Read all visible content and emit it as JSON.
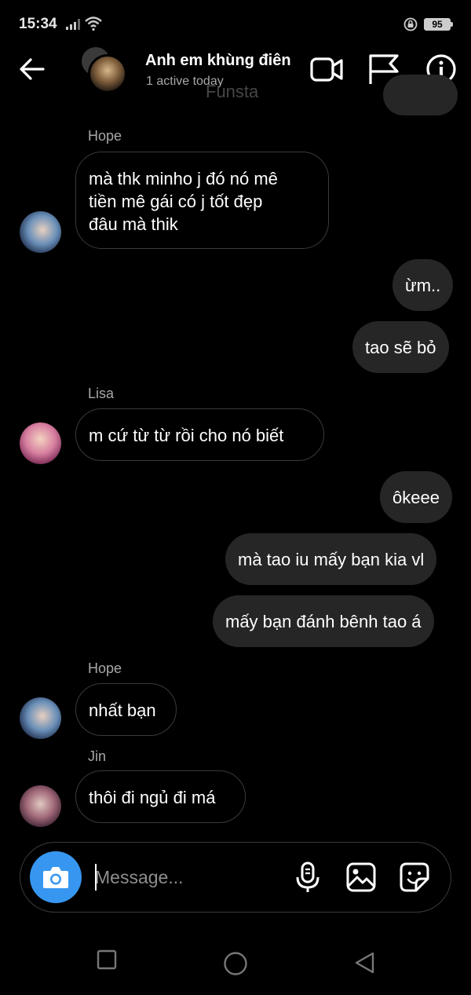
{
  "status": {
    "time": "15:34",
    "battery": "95"
  },
  "header": {
    "title": "Anh em khùng điên",
    "subtitle": "1 active today",
    "watermark": "Funsta"
  },
  "messages": {
    "m1": {
      "sender": "Hope",
      "text_lines": [
        "mà thk minho j đó nó mê",
        "tiền mê gái có j tốt đẹp",
        "đâu mà thik"
      ]
    },
    "m2": {
      "text": "ừm.."
    },
    "m3": {
      "text": "tao sẽ bỏ"
    },
    "m4": {
      "sender": "Lisa",
      "text": "m cứ từ từ rồi cho nó biết"
    },
    "m5": {
      "text": "ôkeee"
    },
    "m6": {
      "text": "mà tao iu mấy bạn kia vl"
    },
    "m7": {
      "text": "mấy bạn đánh bênh tao á"
    },
    "m8": {
      "sender": "Hope",
      "text": "nhất bạn"
    },
    "m9": {
      "sender": "Jin",
      "text": "thôi đi ngủ đi má"
    }
  },
  "composer": {
    "placeholder": "Message..."
  },
  "icons": {
    "back": "arrow-left",
    "video": "video-camera",
    "flag": "flag",
    "info": "info-circle",
    "camera": "camera",
    "mic": "microphone",
    "gallery": "image",
    "sticker": "sticker"
  },
  "colors": {
    "background": "#000000",
    "outgoing_bubble": "#262626",
    "incoming_border": "#3a3a3a",
    "camera_button": "#3797f0",
    "secondary_text": "#a8a8a8"
  }
}
